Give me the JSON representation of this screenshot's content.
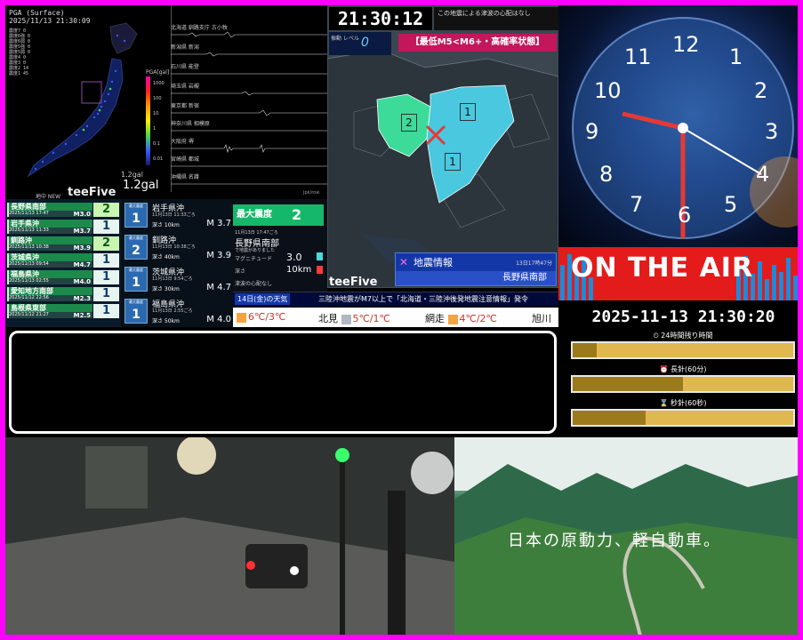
{
  "seismo": {
    "title": "PGA (Surface)",
    "timestamp": "2025/11/13 21:30:09",
    "stats": [
      "震度7 0",
      "震度6強 0",
      "震度6弱 0",
      "震度5強 0",
      "震度5弱 0",
      "震度4 0",
      "震度3 0",
      "震度2 14",
      "震度1 45"
    ],
    "scale_label": "PGA[gal]",
    "scale_ticks": [
      "1000",
      "100",
      "10",
      "1",
      "0.1",
      "0.01"
    ],
    "gal_small": "1.2gal",
    "gal_large": "1.2gal",
    "brand": "teeFive",
    "brand_prefix": "地中 NEW",
    "units": "Jpk/row",
    "stations": [
      "北海道 釧路支庁 古小牧",
      "新潟県 新潟",
      "石川県 能登",
      "埼玉県 岩槻",
      "東京都 新宿",
      "神奈川県 相模原",
      "大阪府 堺",
      "宮崎県 都城",
      "沖縄県 名護"
    ]
  },
  "quake_list": [
    {
      "name": "長野県南部",
      "date": "2025/11/13 17:47",
      "mag": "M3.0",
      "intensity": "2"
    },
    {
      "name": "岩手県沖",
      "date": "2025/11/13 11:33",
      "mag": "M3.7",
      "intensity": "1"
    },
    {
      "name": "釧路沖",
      "date": "2025/11/13 10:38",
      "mag": "M3.9",
      "intensity": "2"
    },
    {
      "name": "茨城県沖",
      "date": "2025/11/13 09:54",
      "mag": "M4.7",
      "intensity": "1"
    },
    {
      "name": "福島県沖",
      "date": "2025/11/13 02:55",
      "mag": "M4.0",
      "intensity": "1"
    },
    {
      "name": "愛知地方南部",
      "date": "2025/11/12 22:56",
      "mag": "M2.3",
      "intensity": "1"
    },
    {
      "name": "島根県東部",
      "date": "2025/11/12 21:27",
      "mag": "M2.5",
      "intensity": "1"
    }
  ],
  "quake_detail": [
    {
      "label": "最大震度",
      "intensity": "1",
      "name": "岩手県沖",
      "time": "11月13日 11:33ごろ",
      "depth": "深さ 10km",
      "mag": "M 3.7"
    },
    {
      "label": "最大震度",
      "intensity": "2",
      "name": "釧路沖",
      "time": "11月13日 10:38ごろ",
      "depth": "深さ 40km",
      "mag": "M 3.9"
    },
    {
      "label": "最大震度",
      "intensity": "1",
      "name": "茨城県沖",
      "time": "11月13日 9:54ごろ",
      "depth": "深さ 30km",
      "mag": "M 4.7"
    },
    {
      "label": "最大震度",
      "intensity": "1",
      "name": "福島県沖",
      "time": "11月13日 2:55ごろ",
      "depth": "深さ 50km",
      "mag": "M 4.0"
    }
  ],
  "max_panel": {
    "title": "最大震度",
    "value": "2",
    "time": "11月13日 17:47ごろ",
    "location": "長野県南部",
    "felt": "で地震がありました",
    "mag_label": "マグニチュード",
    "mag_value": "3.0",
    "depth_label": "深さ",
    "depth_value": "10km",
    "tsunami": "津波の心配なし"
  },
  "ticker": {
    "label": "14日(金)の天気",
    "text": "三陸沖地震がM7以上で「北海道・三陸沖後発地震注意情報」発令"
  },
  "weather": [
    {
      "city": "",
      "temps": "6℃/3℃"
    },
    {
      "city": "北見",
      "temps": "5℃/1℃"
    },
    {
      "city": "網走",
      "temps": "4℃/2℃"
    },
    {
      "city": "旭川",
      "temps": ""
    }
  ],
  "map_panel": {
    "clock": "21:30:12",
    "message": "この地震による津波の心配はなし",
    "level_label": "振動 レベル",
    "level_value": "0",
    "banner": "【最低M5<M6+・高確率状態】",
    "marker_values": [
      "2",
      "1",
      "1"
    ],
    "info_title": "地震情報",
    "info_time": "13日17時47分",
    "info_place": "長野県南部",
    "brand": "teeFive"
  },
  "clock_panel": {
    "numbers": [
      "12",
      "1",
      "2",
      "3",
      "4",
      "5",
      "6",
      "7",
      "8",
      "9",
      "10",
      "11"
    ],
    "on_air": "ON THE AIR",
    "stamp": "2025-11-13 21:30:20",
    "bars": [
      {
        "label": "⏲ 24時間残り時間",
        "fill": 0.11
      },
      {
        "label": "⏰ 長針(60分)",
        "fill": 0.5
      },
      {
        "label": "⌛ 秒針(60秒)",
        "fill": 0.33
      }
    ]
  },
  "landscape": {
    "caption": "日本の原動力、軽自動車。"
  },
  "colors": {
    "frame": "#ff00ff",
    "on_air": "#e31b1b",
    "banner": "#c2185b",
    "info": "#1437a8",
    "intensity_green": "#15b86a"
  }
}
